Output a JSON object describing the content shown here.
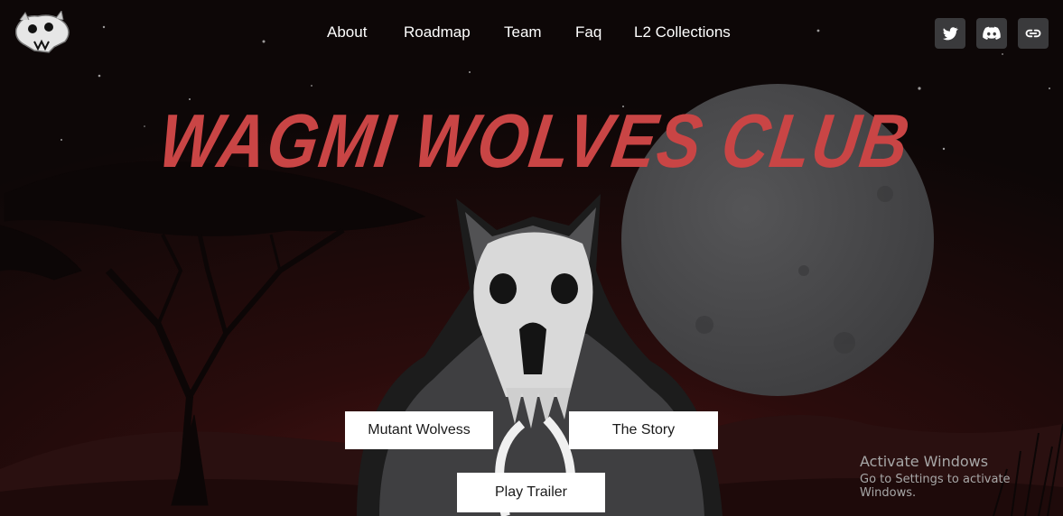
{
  "nav": {
    "items": [
      {
        "label": "About"
      },
      {
        "label": "Roadmap"
      },
      {
        "label": "Team"
      },
      {
        "label": "Faq"
      },
      {
        "label": "L2 Collections"
      }
    ]
  },
  "social": {
    "icons": [
      "twitter-icon",
      "discord-icon",
      "link-icon"
    ]
  },
  "hero": {
    "title": "WAGMI WOLVES CLUB",
    "buttons": {
      "mutant": "Mutant Wolvess",
      "story": "The Story",
      "trailer": "Play Trailer"
    }
  },
  "watermark": {
    "title": "Activate Windows",
    "subtitle": "Go to Settings to activate Windows."
  },
  "colors": {
    "title_red": "#c94545",
    "moon_gray": "#4a4a4c",
    "sky_dark": "#0e0808",
    "horizon_red": "#4a1414",
    "button_bg": "#ffffff",
    "social_bg": "#3a3a3c"
  }
}
